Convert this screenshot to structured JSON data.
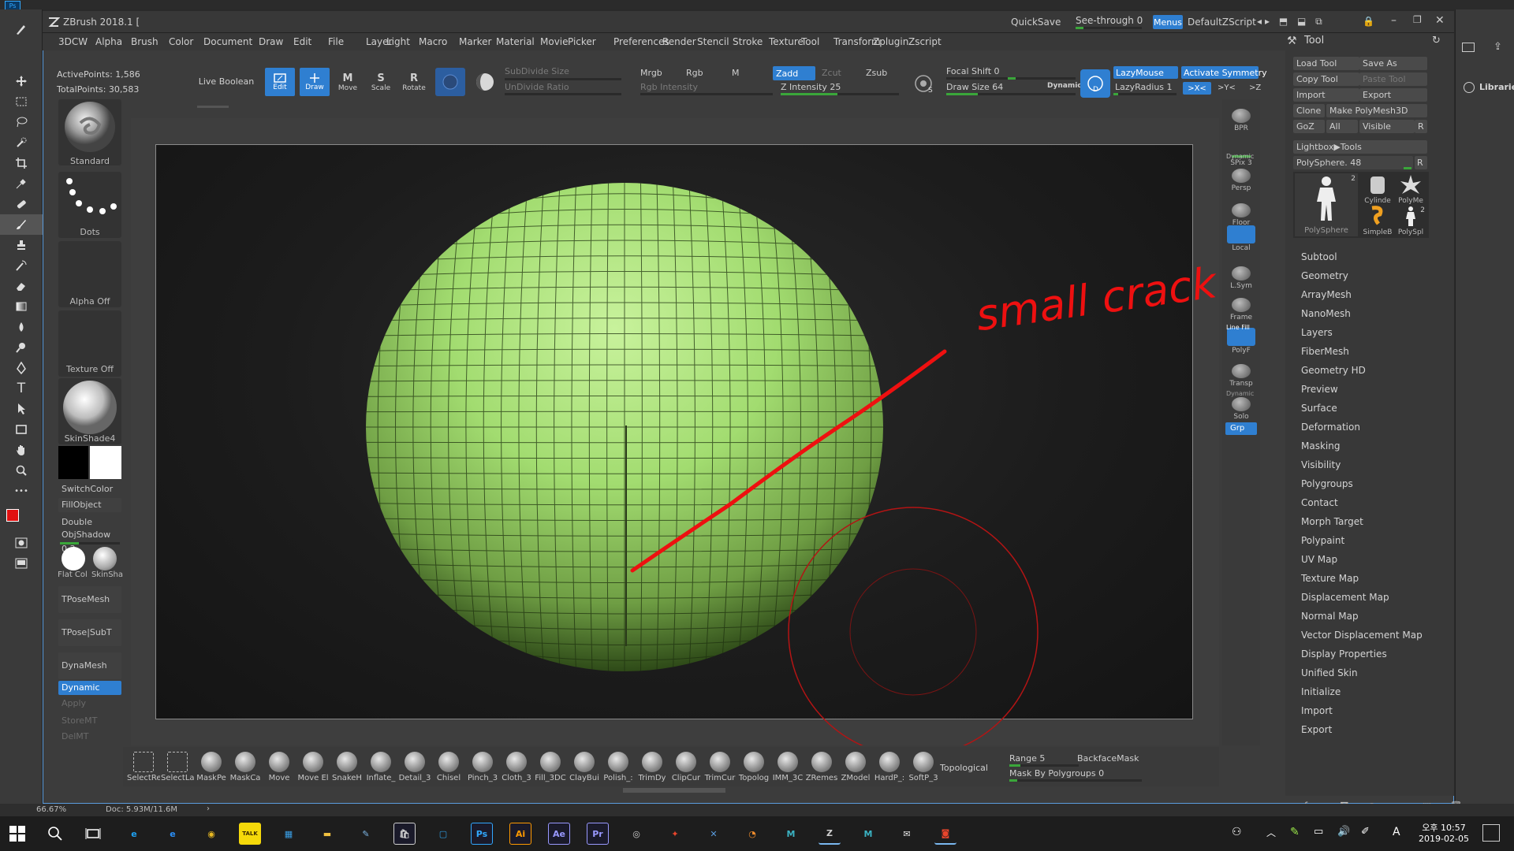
{
  "photoshop": {
    "logo": "Ps",
    "tools": [
      "move-icon",
      "marquee-icon",
      "lasso-icon",
      "quick-select-icon",
      "crop-icon",
      "eyedropper-icon",
      "healing-icon",
      "brush-icon",
      "stamp-icon",
      "history-brush-icon",
      "eraser-icon",
      "gradient-icon",
      "blur-icon",
      "dodge-icon",
      "pen-icon",
      "type-icon",
      "path-select-icon",
      "shape-icon",
      "hand-icon",
      "zoom-icon",
      "more-icon"
    ],
    "type_glyph": "T",
    "more_glyph": "•••",
    "libraries_label": "Libraries",
    "status_zoom": "66.67%",
    "status_doc": "Doc: 5.93M/11.6M"
  },
  "zbrush": {
    "title": "ZBrush 2018.1 [",
    "quicksave": "QuickSave",
    "see_through": "See-through  0",
    "menus_label": "Menus",
    "script_label": "DefaultZScript",
    "menus": [
      "3DCW",
      "Alpha",
      "Brush",
      "Color",
      "Document",
      "Draw",
      "Edit",
      "File",
      "Layer",
      "Light",
      "Macro",
      "Marker",
      "Material",
      "Movie",
      "Picker",
      "Preferences",
      "Render",
      "Stencil",
      "Stroke",
      "Texture",
      "Tool",
      "Transform",
      "Zplugin",
      "Zscript"
    ],
    "active_points": "ActivePoints: 1,586",
    "total_points": "TotalPoints: 30,583",
    "live_boolean": "Live Boolean",
    "modes": [
      {
        "label": "Edit",
        "active": true
      },
      {
        "label": "Draw",
        "active": true
      },
      {
        "label": "Move",
        "active": false
      },
      {
        "label": "Scale",
        "active": false
      },
      {
        "label": "Rotate",
        "active": false
      }
    ],
    "subdivide_size": "SubDivide Size",
    "undivide_ratio": "UnDivide Ratio",
    "mrgb": "Mrgb",
    "rgb": "Rgb",
    "m": "M",
    "rgb_intensity": "Rgb Intensity",
    "zadd": "Zadd",
    "zcut": "Zcut",
    "zsub": "Zsub",
    "z_intensity": "Z Intensity 25",
    "focal_shift": "Focal Shift 0",
    "draw_size": "Draw Size 64",
    "dynamic": "Dynamic",
    "lazymouse": "LazyMouse",
    "lazyradius": "LazyRadius 1",
    "activate_symmetry": "Activate Symmetry",
    "sym_x": ">X<",
    "sym_y": ">Y<",
    "sym_z": ">Z",
    "left_shelf": {
      "brush": "Standard",
      "stroke": "Dots",
      "alpha": "Alpha Off",
      "texture": "Texture Off",
      "material": "SkinShade4",
      "switch_color": "SwitchColor",
      "fill_object": "FillObject",
      "double": "Double",
      "obj_shadow": "ObjShadow 0.3",
      "flat_col": "Flat Col",
      "skin_sha": "SkinSha",
      "tpose_mesh": "TPoseMesh",
      "tpose_subt": "TPose|SubT",
      "dynamesh": "DynaMesh",
      "dynamic": "Dynamic",
      "apply": "Apply",
      "store_mt": "StoreMT",
      "del_mt": "DelMT"
    },
    "right_shelf": [
      {
        "label": "BPR",
        "icon": "bpr-icon",
        "active": false
      },
      {
        "label": "SPix 3",
        "icon": "spix-icon",
        "active": false
      },
      {
        "label": "Persp",
        "icon": "persp-icon",
        "active": false
      },
      {
        "label": "Floor",
        "icon": "floor-icon",
        "active": false
      },
      {
        "label": "Local",
        "icon": "local-icon",
        "active": true
      },
      {
        "label": "L.Sym",
        "icon": "lsym-icon",
        "active": false
      },
      {
        "label": "Frame",
        "icon": "frame-icon",
        "active": false
      },
      {
        "label": "PolyF",
        "icon": "polyf-icon",
        "active": true
      },
      {
        "label": "Transp",
        "icon": "transp-icon",
        "active": false
      },
      {
        "label": "Solo",
        "icon": "solo-icon",
        "active": false
      },
      {
        "label": "Grp",
        "icon": "grp-icon",
        "active": true
      }
    ],
    "right_shelf_extra": {
      "dynamic_top": "Dynamic",
      "line_fill": "Line Fill",
      "dynamic_solo": "Dynamic"
    },
    "annotation": "small crack!",
    "tool_panel": {
      "title": "Tool",
      "buttons": [
        "Load Tool",
        "Save As",
        "Copy Tool",
        "Paste Tool",
        "Import",
        "Export",
        "Clone",
        "Make PolyMesh3D",
        "GoZ",
        "All",
        "Visible",
        "R"
      ],
      "lightbox": "Lightbox▶Tools",
      "polysphere": "PolySphere. 48",
      "polysphere_r": "R",
      "thumbs": [
        "PolySphere",
        "Cylinde",
        "PolyMe",
        "SimpleB",
        "PolySpl"
      ],
      "thumb_badge_main": "2",
      "thumb_badge_small": "2",
      "sections": [
        "Subtool",
        "Geometry",
        "ArrayMesh",
        "NanoMesh",
        "Layers",
        "FiberMesh",
        "Geometry HD",
        "Preview",
        "Surface",
        "Deformation",
        "Masking",
        "Visibility",
        "Polygroups",
        "Contact",
        "Morph Target",
        "Polypaint",
        "UV Map",
        "Texture Map",
        "Displacement Map",
        "Normal Map",
        "Vector Displacement Map",
        "Display Properties",
        "Unified Skin",
        "Initialize",
        "Import",
        "Export"
      ]
    },
    "bottom_brushes": [
      "SelectRe",
      "SelectLa",
      "MaskPe",
      "MaskCa",
      "Move",
      "Move El",
      "SnakeH",
      "Inflate_",
      "Detail_3",
      "Chisel",
      "Pinch_3",
      "Cloth_3",
      "Fill_3DC",
      "ClayBui",
      "Polish_:",
      "TrimDy",
      "ClipCur",
      "TrimCur",
      "Topolog",
      "IMM_3C",
      "ZRemes",
      "ZModel",
      "HardP_:",
      "SoftP_3"
    ],
    "topological": "Topological",
    "range": "Range 5",
    "backface_mask": "BackfaceMask",
    "mask_by_polygroups": "Mask By Polygroups 0"
  },
  "taskbar": {
    "apps": [
      {
        "name": "ie-icon",
        "glyph": "e",
        "color": "#1ea1f2"
      },
      {
        "name": "edge-icon",
        "glyph": "e",
        "color": "#2a8ff7"
      },
      {
        "name": "chrome-icon",
        "glyph": "◉",
        "color": "#e8b923"
      },
      {
        "name": "kakaotalk-icon",
        "glyph": "TALK",
        "color": "#f5d90a"
      },
      {
        "name": "store-app-icon",
        "glyph": "▦",
        "color": "#3aa0e8"
      },
      {
        "name": "explorer-icon",
        "glyph": "▬",
        "color": "#f0c040"
      },
      {
        "name": "pencil-app-icon",
        "glyph": "✎",
        "color": "#7fb8e8"
      },
      {
        "name": "ms-store-icon",
        "glyph": "🛍",
        "color": "#cfcfcf"
      },
      {
        "name": "app-blue-icon",
        "glyph": "▢",
        "color": "#2e9be0"
      },
      {
        "name": "photoshop-icon",
        "glyph": "Ps",
        "color": "#31a8ff"
      },
      {
        "name": "illustrator-icon",
        "glyph": "Ai",
        "color": "#ff9a00"
      },
      {
        "name": "after-effects-icon",
        "glyph": "Ae",
        "color": "#9999ff"
      },
      {
        "name": "premiere-icon",
        "glyph": "Pr",
        "color": "#9999ff"
      },
      {
        "name": "spiral-app-icon",
        "glyph": "◎",
        "color": "#cfcfcf"
      },
      {
        "name": "red-app-icon",
        "glyph": "✦",
        "color": "#e8452c"
      },
      {
        "name": "x-app-icon",
        "glyph": "✕",
        "color": "#5a9bdc"
      },
      {
        "name": "blender-icon",
        "glyph": "◔",
        "color": "#f08c2c"
      },
      {
        "name": "maya-icon",
        "glyph": "M",
        "color": "#3bb3c3"
      },
      {
        "name": "zbrush-taskbar-icon",
        "glyph": "Z",
        "color": "#cfcfcf"
      },
      {
        "name": "maya2-icon",
        "glyph": "M",
        "color": "#3bb3c3"
      },
      {
        "name": "mail-icon",
        "glyph": "✉",
        "color": "#e6e6e6"
      },
      {
        "name": "camera-app-icon",
        "glyph": "◙",
        "color": "#e8452c"
      }
    ],
    "time": "오후 10:57",
    "date": "2019-02-05",
    "ime": "A"
  }
}
